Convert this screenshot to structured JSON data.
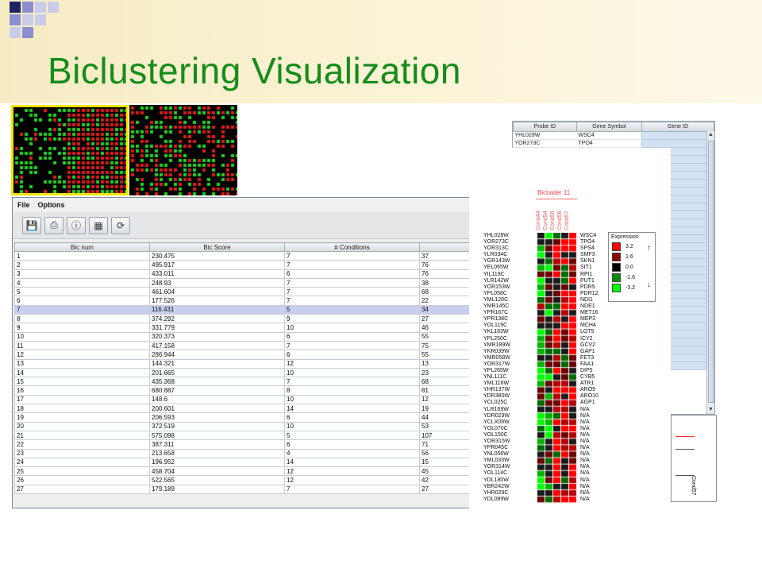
{
  "slide": {
    "title": "Biclustering Visualization",
    "deco_colors": [
      "#202266",
      "#8b8fd0",
      "#c9cbe9"
    ],
    "title_color": "#168c1b"
  },
  "menubar": {
    "items": [
      "File",
      "Options"
    ]
  },
  "toolbar": {
    "icons": [
      "save-icon",
      "print-icon",
      "info-icon",
      "table-icon",
      "refresh-icon"
    ]
  },
  "bic_table": {
    "columns": [
      "Bic num",
      "Bic Score",
      "# Conditions",
      ""
    ],
    "selected_row": 7,
    "rows": [
      [
        "1",
        "230.475",
        "7",
        "37"
      ],
      [
        "2",
        "495.917",
        "7",
        "76"
      ],
      [
        "3",
        "433.011",
        "6",
        "76"
      ],
      [
        "4",
        "248.93",
        "7",
        "38"
      ],
      [
        "5",
        "461.604",
        "7",
        "68"
      ],
      [
        "6",
        "177.526",
        "7",
        "22"
      ],
      [
        "7",
        "116.431",
        "5",
        "34"
      ],
      [
        "8",
        "374.292",
        "9",
        "27"
      ],
      [
        "9",
        "331.779",
        "10",
        "46"
      ],
      [
        "10",
        "320.373",
        "6",
        "55"
      ],
      [
        "11",
        "417.158",
        "7",
        "75"
      ],
      [
        "12",
        "286.944",
        "6",
        "55"
      ],
      [
        "13",
        "144.321",
        "12",
        "13"
      ],
      [
        "14",
        "201.665",
        "10",
        "23"
      ],
      [
        "15",
        "435.368",
        "7",
        "68"
      ],
      [
        "16",
        "680.887",
        "8",
        "81"
      ],
      [
        "17",
        "148.6",
        "10",
        "12"
      ],
      [
        "18",
        "200.601",
        "14",
        "19"
      ],
      [
        "19",
        "206.593",
        "6",
        "44"
      ],
      [
        "20",
        "372.519",
        "10",
        "53"
      ],
      [
        "21",
        "575.098",
        "5",
        "107"
      ],
      [
        "22",
        "387.311",
        "6",
        "71"
      ],
      [
        "23",
        "213.658",
        "4",
        "56"
      ],
      [
        "24",
        "196.952",
        "14",
        "15"
      ],
      [
        "25",
        "458.704",
        "12",
        "45"
      ],
      [
        "26",
        "522.565",
        "12",
        "42"
      ],
      [
        "27",
        "179.189",
        "7",
        "27"
      ]
    ]
  },
  "gene_table": {
    "columns": [
      "Probe ID",
      "Gene Symbol",
      "Gene ID"
    ],
    "rows": [
      [
        "YHL028W",
        "WSC4",
        ""
      ],
      [
        "YOR273C",
        "TPO4",
        ""
      ]
    ]
  },
  "bicluster": {
    "title": "Bicluster 11",
    "conditions": [
      "Cond44",
      "Cond54",
      "Cond55",
      "Cond56",
      "Cond57"
    ],
    "probes": [
      "YHL028W",
      "YOR273C",
      "YOR313C",
      "YLR034C",
      "YGR143W",
      "YEL065W",
      "YIL119C",
      "YLR142W",
      "YOR153W",
      "YPL058C",
      "YML120C",
      "YMR145C",
      "YPR167C",
      "YPR138C",
      "YOL119C",
      "YKL183W",
      "YPL250C",
      "YMR189W",
      "YKR039W",
      "YMR058W",
      "YOR317W",
      "YPL265W",
      "YNL111C",
      "YML116W",
      "YHR137W",
      "YDR380W",
      "YCL025C",
      "YLR169W",
      "YDR029W",
      "YCLX09W",
      "YOL070C",
      "YOL150C",
      "YOR315W",
      "YPR045C",
      "YNL056W",
      "YML033W",
      "YOR314W",
      "YOL114C",
      "YDL180W",
      "YBR242W",
      "YHR029C",
      "YDL089W"
    ],
    "symbols": [
      "WSC4",
      "TPO4",
      "SPS4",
      "SMF3",
      "SKN1",
      "SIT1",
      "RPI1",
      "PUT1",
      "PDR5",
      "PDR12",
      "NDI1",
      "NDE1",
      "MET16",
      "MEP3",
      "MCH4",
      "LOT5",
      "ICY2",
      "GCV2",
      "GAP1",
      "FET3",
      "FAA1",
      "DIP5",
      "CYB5",
      "ATR1",
      "ARO9",
      "ARO10",
      "AGP1",
      "N/A",
      "N/A",
      "N/A",
      "N/A",
      "N/A",
      "N/A",
      "N/A",
      "N/A",
      "N/A",
      "N/A",
      "N/A",
      "N/A",
      "N/A",
      "N/A",
      "N/A"
    ],
    "legend": {
      "title": "Expression",
      "entries": [
        {
          "label": "3.2",
          "color": "#ff0000"
        },
        {
          "label": "1.6",
          "color": "#8c0000"
        },
        {
          "label": "0.0",
          "color": "#000000"
        },
        {
          "label": "-1.6",
          "color": "#008c00"
        },
        {
          "label": "-3.2",
          "color": "#00ff00"
        }
      ]
    }
  },
  "minipanel": {
    "label": "Cond57"
  }
}
